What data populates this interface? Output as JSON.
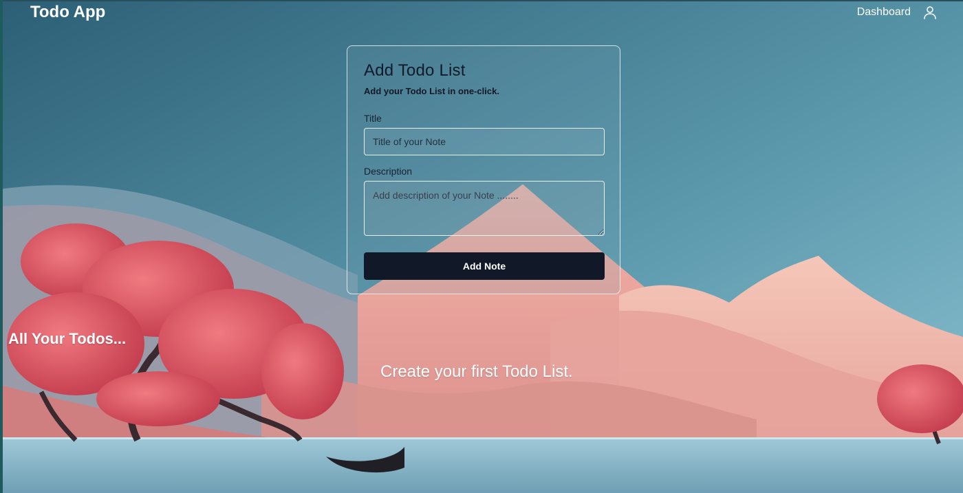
{
  "navbar": {
    "brand": "Todo App",
    "dashboard_link": "Dashboard",
    "user_icon": "user-icon"
  },
  "form": {
    "title": "Add Todo List",
    "subtitle": "Add your Todo List in one-click.",
    "title_label": "Title",
    "title_placeholder": "Title of your Note",
    "description_label": "Description",
    "description_placeholder": "Add description of your Note ........",
    "submit_label": "Add Note"
  },
  "todos": {
    "heading": "All Your Todos...",
    "empty_message": "Create your first Todo List."
  },
  "colors": {
    "button_bg": "#111827",
    "text_light": "#ffffff",
    "sky_top": "#2f6479",
    "mountain_pink": "#e89a96",
    "tree_red": "#d84a55"
  }
}
